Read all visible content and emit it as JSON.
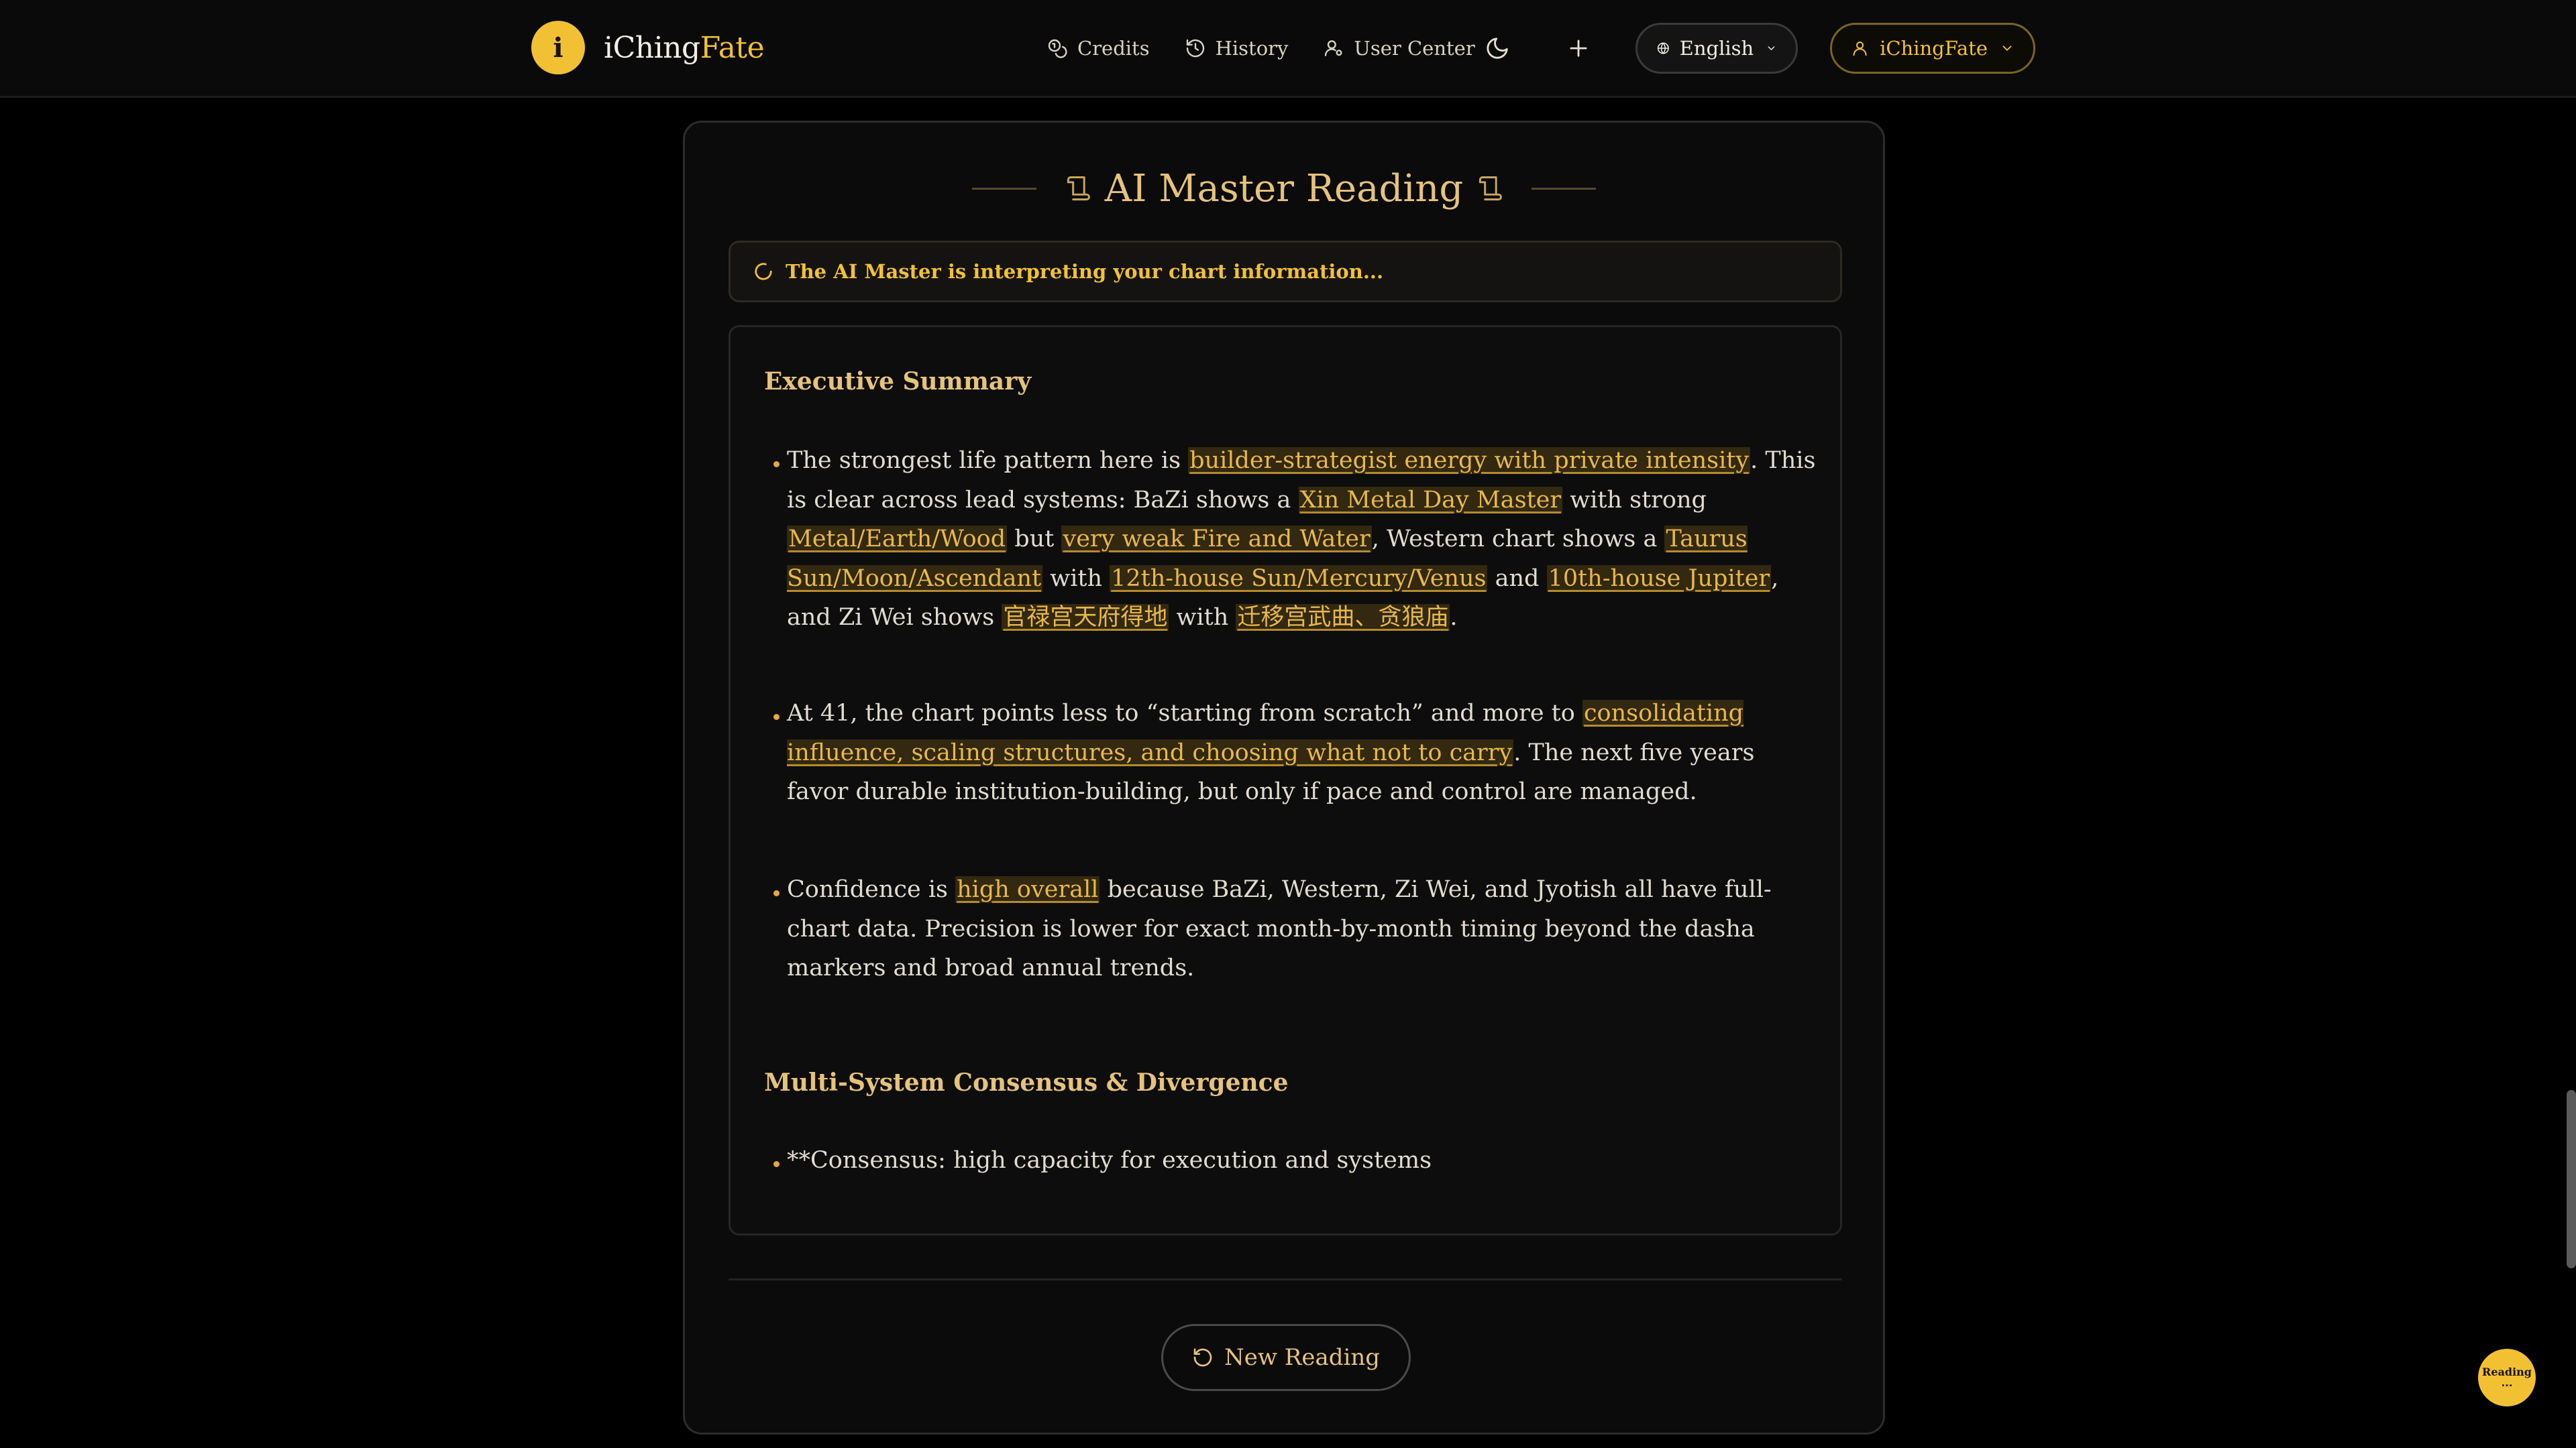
{
  "header": {
    "logo_letter": "i",
    "brand_main": "iChing",
    "brand_accent": "Fate",
    "nav": [
      {
        "label": "Credits",
        "icon": "coins-icon"
      },
      {
        "label": "History",
        "icon": "history-icon"
      },
      {
        "label": "User Center",
        "icon": "user-settings-icon"
      }
    ],
    "theme_toggle_icon": "moon-icon",
    "add_icon": "plus-icon",
    "language": "English",
    "user": "iChingFate"
  },
  "reading": {
    "title": "AI Master Reading",
    "status": "The AI Master is interpreting your chart information...",
    "sections": [
      {
        "heading": "Executive Summary"
      },
      {
        "heading": "Multi-System Consensus & Divergence"
      }
    ],
    "bullet1": {
      "t1": "The strongest life pattern here is ",
      "h1": "builder-strategist energy with private intensity",
      "t2": ". This is clear across lead systems: BaZi shows a ",
      "h2": "Xin Metal Day Master",
      "t3": " with strong ",
      "h3": "Metal/Earth/Wood",
      "t4": " but ",
      "h4": "very weak Fire and Water",
      "t5": ", Western chart shows a ",
      "h5": "Taurus Sun/Moon/Ascendant",
      "t6": " with ",
      "h6": "12th-house Sun/Mercury/Venus",
      "t7": " and ",
      "h7": "10th-house Jupiter",
      "t8": ", and Zi Wei shows ",
      "h8": "官禄宫天府得地",
      "t9": " with ",
      "h9": "迁移宫武曲、贪狼庙",
      "t10": "."
    },
    "bullet2": {
      "t1": "At 41, the chart points less to “starting from scratch” and more to ",
      "h1": "consolidating influence, scaling structures, and choosing what not to carry",
      "t2": ". The next five years favor durable institution-building, but only if pace and control are managed."
    },
    "bullet3": {
      "t1": "Confidence is ",
      "h1": "high overall",
      "t2": " because BaZi, Western, Zi Wei, and Jyotish all have full-chart data. Precision is lower for exact month-by-month timing beyond the dasha markers and broad annual trends."
    },
    "bullet4": {
      "t1": "**Consensus: high capacity for execution and systems"
    },
    "new_reading_label": "New Reading"
  },
  "floating_badge": {
    "label": "Reading",
    "sub": "..."
  },
  "colors": {
    "accent": "#f2c133",
    "heading_gold": "#e6c27a",
    "background": "#000000"
  }
}
